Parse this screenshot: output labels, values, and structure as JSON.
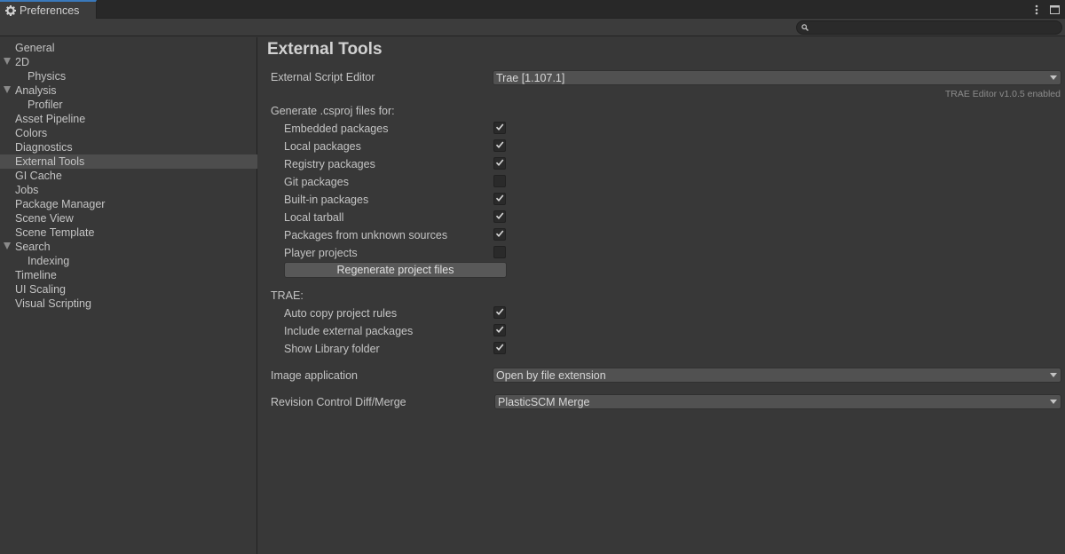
{
  "window": {
    "tab_title": "Preferences",
    "controls": [
      "more-menu",
      "maximize"
    ]
  },
  "search": {
    "value": "",
    "placeholder": ""
  },
  "sidebar": {
    "items": [
      {
        "label": "General",
        "level": 0
      },
      {
        "label": "2D",
        "level": 0,
        "expanded": true
      },
      {
        "label": "Physics",
        "level": 1
      },
      {
        "label": "Analysis",
        "level": 0,
        "expanded": true
      },
      {
        "label": "Profiler",
        "level": 1
      },
      {
        "label": "Asset Pipeline",
        "level": 0
      },
      {
        "label": "Colors",
        "level": 0
      },
      {
        "label": "Diagnostics",
        "level": 0
      },
      {
        "label": "External Tools",
        "level": 0,
        "selected": true
      },
      {
        "label": "GI Cache",
        "level": 0
      },
      {
        "label": "Jobs",
        "level": 0
      },
      {
        "label": "Package Manager",
        "level": 0
      },
      {
        "label": "Scene View",
        "level": 0
      },
      {
        "label": "Scene Template",
        "level": 0
      },
      {
        "label": "Search",
        "level": 0,
        "expanded": true
      },
      {
        "label": "Indexing",
        "level": 1
      },
      {
        "label": "Timeline",
        "level": 0
      },
      {
        "label": "UI Scaling",
        "level": 0
      },
      {
        "label": "Visual Scripting",
        "level": 0
      }
    ]
  },
  "main": {
    "title": "External Tools",
    "external_script_editor": {
      "label": "External Script Editor",
      "value": "Trae [1.107.1]",
      "note": "TRAE Editor v1.0.5 enabled"
    },
    "generate_csproj": {
      "label": "Generate .csproj files for:",
      "options": [
        {
          "label": "Embedded packages",
          "checked": true
        },
        {
          "label": "Local packages",
          "checked": true
        },
        {
          "label": "Registry packages",
          "checked": true
        },
        {
          "label": "Git packages",
          "checked": false
        },
        {
          "label": "Built-in packages",
          "checked": true
        },
        {
          "label": "Local tarball",
          "checked": true
        },
        {
          "label": "Packages from unknown sources",
          "checked": true
        },
        {
          "label": "Player projects",
          "checked": false
        }
      ],
      "regenerate_label": "Regenerate project files"
    },
    "trae": {
      "label": "TRAE:",
      "options": [
        {
          "label": "Auto copy project rules",
          "checked": true
        },
        {
          "label": "Include external packages",
          "checked": true
        },
        {
          "label": "Show Library folder",
          "checked": true
        }
      ]
    },
    "image_application": {
      "label": "Image application",
      "value": "Open by file extension"
    },
    "revision_control": {
      "label": "Revision Control Diff/Merge",
      "value": "PlasticSCM Merge"
    }
  },
  "colors": {
    "background": "#383838",
    "selection": "#4d4d4d",
    "tab_accent": "#3a79bb"
  }
}
